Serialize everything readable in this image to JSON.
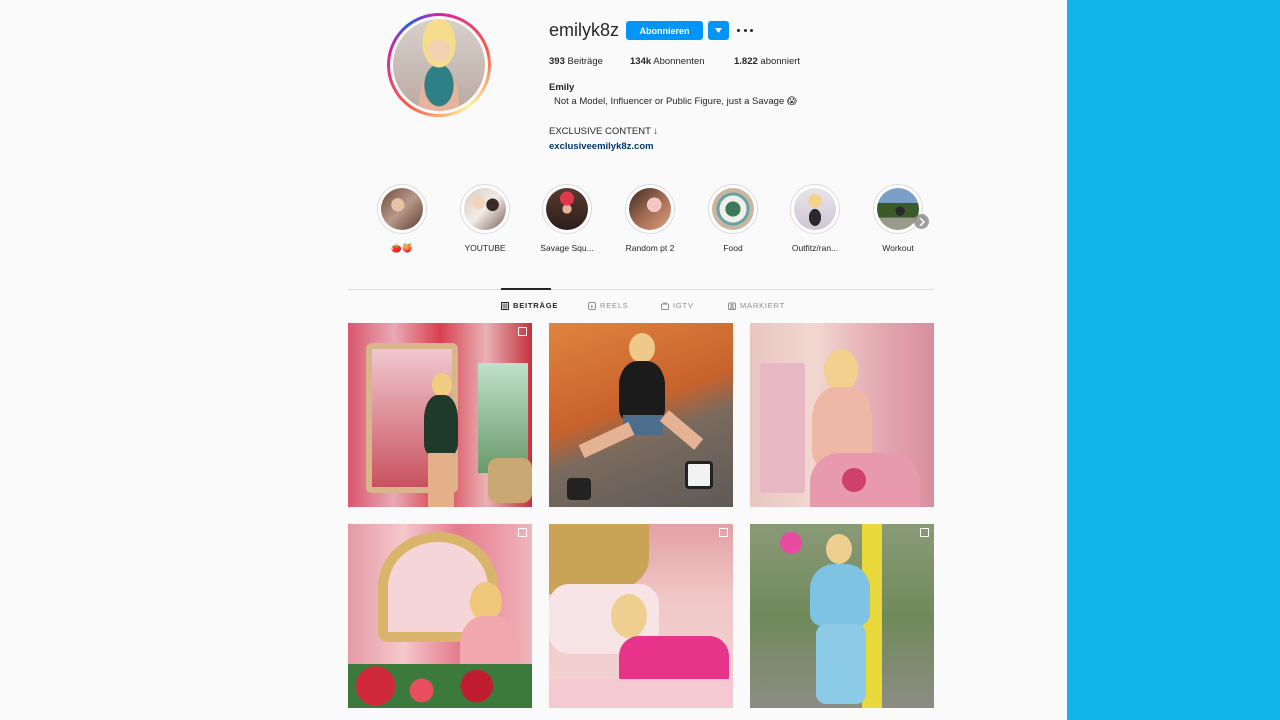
{
  "profile": {
    "username": "emilyk8z",
    "follow_label": "Abonnieren",
    "stats": {
      "posts_count": "393",
      "posts_label": "Beiträge",
      "followers_count": "134k",
      "followers_label": "Abonnenten",
      "following_count": "1.822",
      "following_label": "abonniert"
    },
    "bio": {
      "name": "Emily",
      "line1": "Not a Model, Influencer or Public Figure, just a Savage 😱",
      "line2": "EXCLUSIVE CONTENT ↓",
      "link": "exclusiveemilyk8z.com"
    }
  },
  "highlights": [
    {
      "label": "🍅🍑",
      "icon": "highlight-cover"
    },
    {
      "label": "YOUTUBE",
      "icon": "highlight-cover"
    },
    {
      "label": "Savage Squ...",
      "icon": "highlight-cover"
    },
    {
      "label": "Random pt 2",
      "icon": "highlight-cover"
    },
    {
      "label": "Food",
      "icon": "highlight-cover"
    },
    {
      "label": "Outfitz/ran...",
      "icon": "highlight-cover"
    },
    {
      "label": "Workout",
      "icon": "highlight-cover"
    }
  ],
  "tabs": [
    {
      "label": "BEITRÄGE",
      "icon": "grid-icon",
      "active": true
    },
    {
      "label": "REELS",
      "icon": "reels-icon",
      "active": false
    },
    {
      "label": "IGTV",
      "icon": "igtv-icon",
      "active": false
    },
    {
      "label": "MARKIERT",
      "icon": "tagged-icon",
      "active": false
    }
  ],
  "posts": [
    {
      "type": "carousel",
      "icon": "multiple-posts-icon"
    },
    {
      "type": "single"
    },
    {
      "type": "single"
    },
    {
      "type": "carousel",
      "icon": "multiple-posts-icon"
    },
    {
      "type": "carousel",
      "icon": "multiple-posts-icon"
    },
    {
      "type": "carousel",
      "icon": "multiple-posts-icon"
    }
  ],
  "colors": {
    "accent": "#0095f6",
    "link": "#00376b",
    "side_panel": "#12b5ea",
    "background": "#fafafa"
  }
}
